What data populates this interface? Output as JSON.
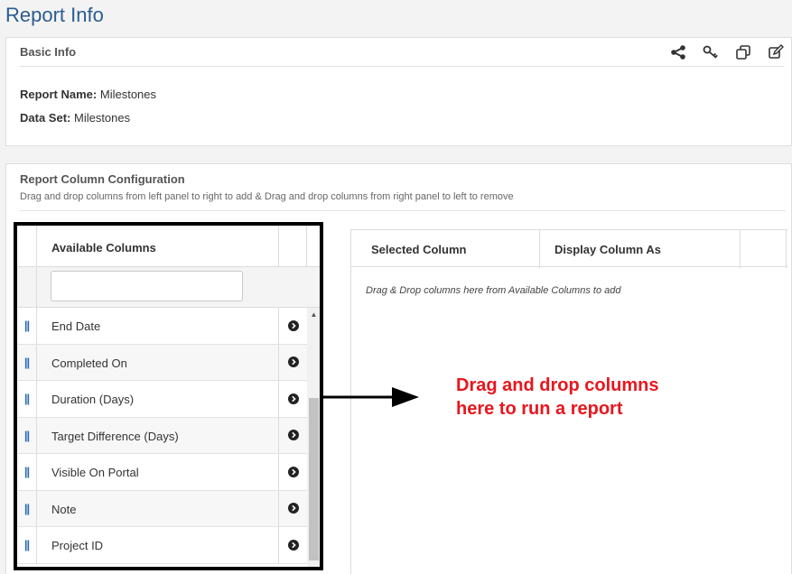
{
  "page": {
    "title": "Report Info"
  },
  "basic_info": {
    "heading": "Basic Info",
    "tools": [
      {
        "icon": "share-icon"
      },
      {
        "icon": "key-icon"
      },
      {
        "icon": "copy-icon"
      },
      {
        "icon": "edit-icon"
      }
    ],
    "report_name_label": "Report Name:",
    "report_name": "Milestones",
    "data_set_label": "Data Set:",
    "data_set": "Milestones"
  },
  "config": {
    "heading": "Report Column Configuration",
    "description": "Drag and drop columns from left panel to right to add & Drag and drop columns from right panel to left to remove",
    "available": {
      "header": "Available Columns",
      "filter_value": "",
      "items": [
        {
          "label": "End Date"
        },
        {
          "label": "Completed On"
        },
        {
          "label": "Duration (Days)"
        },
        {
          "label": "Target Difference (Days)"
        },
        {
          "label": "Visible On Portal"
        },
        {
          "label": "Note"
        },
        {
          "label": "Project ID"
        }
      ]
    },
    "selected": {
      "col1": "Selected Column",
      "col2": "Display Column As",
      "empty_hint": "Drag & Drop columns here from Available Columns to add"
    }
  },
  "annotation": {
    "line1": "Drag and drop columns",
    "line2": "here to run a report",
    "color": "#e8161d"
  },
  "colors": {
    "title": "#2c5d8f",
    "handle": "#2b6cb0"
  }
}
